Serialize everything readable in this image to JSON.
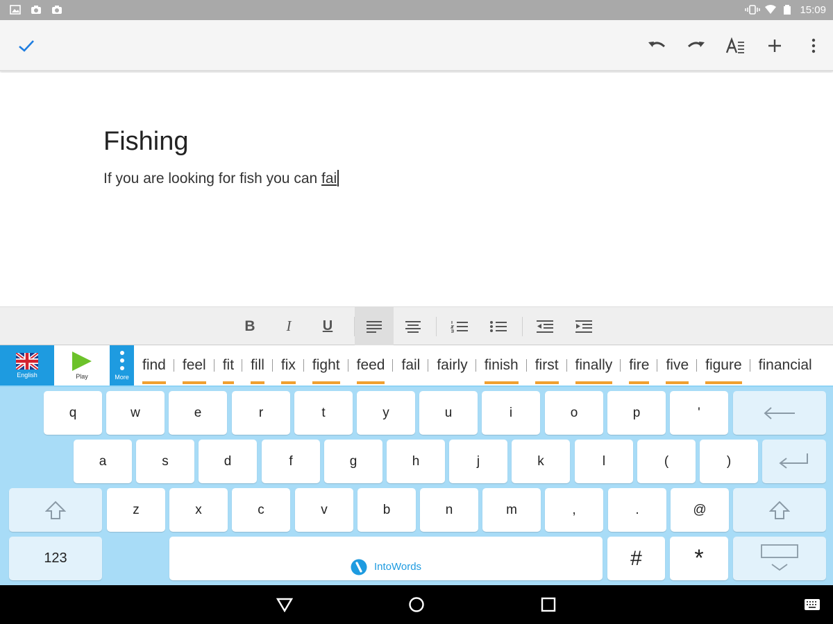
{
  "status_bar": {
    "time": "15:09",
    "left_icons": [
      "image-icon",
      "photo-icon",
      "photo-icon"
    ],
    "right_icons": [
      "vibrate-icon",
      "wifi-icon",
      "battery-icon"
    ]
  },
  "toolbar": {
    "icons": [
      "check-icon",
      "undo-icon",
      "redo-icon",
      "text-format-icon",
      "plus-icon",
      "more-icon"
    ]
  },
  "document": {
    "title": "Fishing",
    "body_text": "If you are looking for fish you can ",
    "typed_word": "fai"
  },
  "format_bar": {
    "bold": "B",
    "italic": "I",
    "underline": "U",
    "icons": [
      "align-left-icon",
      "align-center-icon",
      "numbered-list-icon",
      "bullet-list-icon",
      "outdent-icon",
      "indent-icon"
    ]
  },
  "prediction_bar": {
    "language_label": "English",
    "play_label": "Play",
    "more_label": "More",
    "words": [
      "find",
      "feel",
      "fit",
      "fill",
      "fix",
      "fight",
      "feed",
      "fail",
      "fairly",
      "finish",
      "first",
      "finally",
      "fire",
      "five",
      "figure",
      "financial"
    ],
    "underlined": [
      true,
      true,
      true,
      true,
      true,
      true,
      true,
      false,
      false,
      true,
      true,
      true,
      true,
      true,
      true,
      false
    ]
  },
  "keyboard": {
    "row1": [
      "q",
      "w",
      "e",
      "r",
      "t",
      "y",
      "u",
      "i",
      "o",
      "p",
      "'"
    ],
    "row2": [
      "a",
      "s",
      "d",
      "f",
      "g",
      "h",
      "j",
      "k",
      "l",
      "(",
      ")"
    ],
    "row3": [
      "z",
      "x",
      "c",
      "v",
      "b",
      "n",
      "m",
      ",",
      ".",
      "@"
    ],
    "numbers_key": "123",
    "space_label": "IntoWords",
    "hash_key": "#",
    "star_key": "*",
    "accent_color": "#a8dcf7",
    "brand_color": "#1e9be0"
  },
  "nav_bar": {
    "icons": [
      "back-icon",
      "home-icon",
      "recents-icon",
      "keyboard-icon"
    ]
  }
}
